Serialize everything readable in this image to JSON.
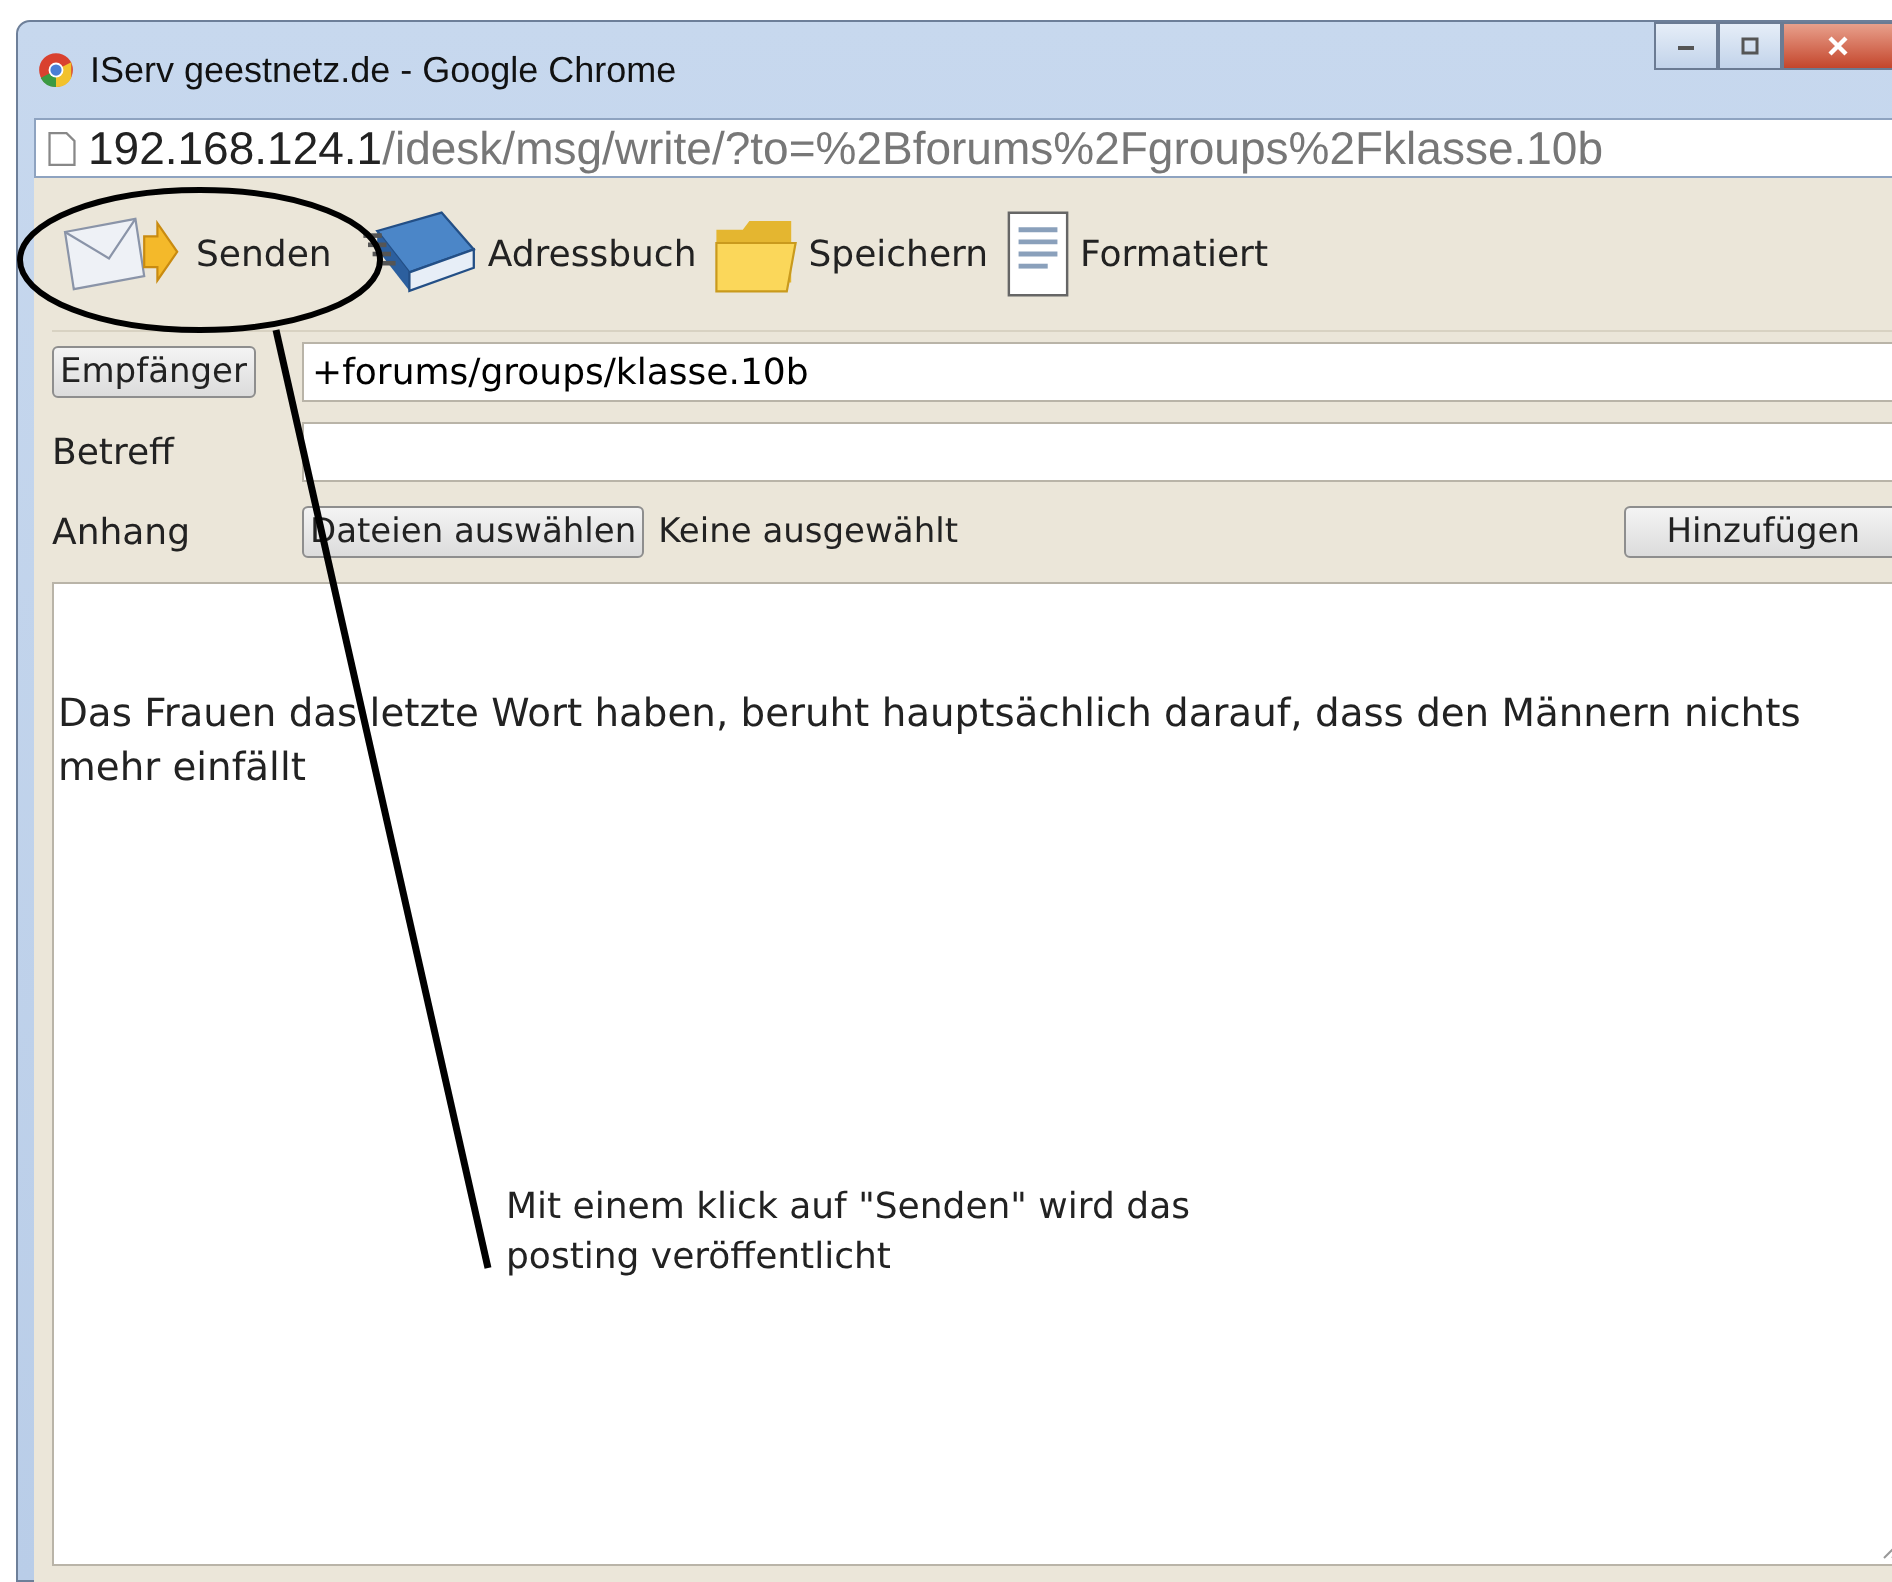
{
  "window": {
    "title": "IServ geestnetz.de - Google Chrome"
  },
  "address_bar": {
    "host": "192.168.124.1",
    "path": "/idesk/msg/write/?to=%2Bforums%2Fgroups%2Fklasse.10b"
  },
  "toolbar": [
    {
      "kind": "send",
      "label": "Senden"
    },
    {
      "kind": "book",
      "label": "Adressbuch"
    },
    {
      "kind": "folder",
      "label": "Speichern"
    },
    {
      "kind": "document",
      "label": "Formatiert"
    }
  ],
  "recipient": {
    "button": "Empfänger",
    "value": "+forums/groups/klasse.10b"
  },
  "subject": {
    "label": "Betreff"
  },
  "attachment": {
    "label": "Anhang",
    "choose_button": "Dateien auswählen",
    "status": "Keine ausgewählt",
    "add_button": "Hinzufügen"
  },
  "message": {
    "lines": [
      "Das Frauen das letzte Wort haben, beruht hauptsächlich darauf, dass den Männern nichts",
      "mehr einfällt"
    ]
  },
  "annotation": {
    "lines": [
      "Mit einem klick auf \"Senden\" wird das",
      "posting veröffentlicht"
    ]
  }
}
